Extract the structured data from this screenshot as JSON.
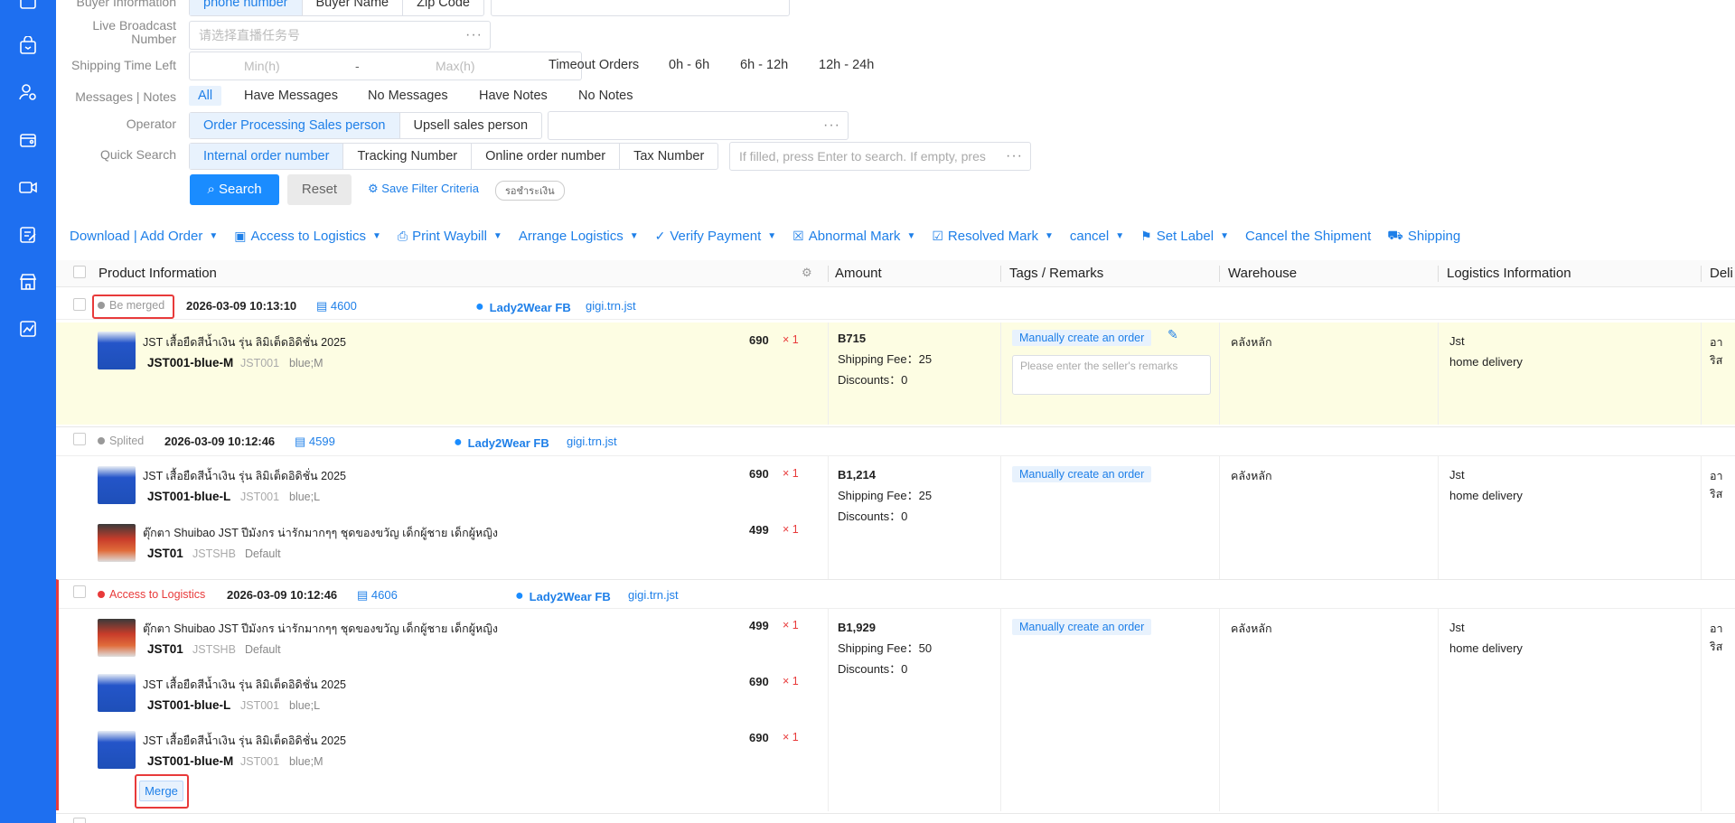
{
  "filters": {
    "buyer_info_label": "Buyer Information",
    "buyer_info_options": [
      "phone number",
      "Buyer Name",
      "Zip Code"
    ],
    "live_label": "Live Broadcast Number",
    "live_placeholder": "请选择直播任务号",
    "shipping_label": "Shipping Time Left",
    "min_placeholder": "Min(h)",
    "range_sep": "-",
    "max_placeholder": "Max(h)",
    "timeout_options": [
      "Timeout Orders",
      "0h - 6h",
      "6h - 12h",
      "12h - 24h"
    ],
    "messages_label": "Messages | Notes",
    "messages_options": [
      "All",
      "Have Messages",
      "No Messages",
      "Have Notes",
      "No Notes"
    ],
    "operator_label": "Operator",
    "operator_options": [
      "Order Processing Sales person",
      "Upsell sales person"
    ],
    "quick_label": "Quick Search",
    "quick_options": [
      "Internal order number",
      "Tracking Number",
      "Online order number",
      "Tax Number"
    ],
    "quick_placeholder": "If filled, press Enter to search. If empty, pres",
    "search_button": "Search",
    "reset_button": "Reset",
    "save_filter": "Save Filter Criteria",
    "saved_pill": "รอชำระเงิน"
  },
  "toolbar": [
    "Download | Add Order",
    "Access to Logistics",
    "Print Waybill",
    "Arrange Logistics",
    "Verify Payment",
    "Abnormal Mark",
    "Resolved Mark",
    "cancel",
    "Set Label",
    "Cancel the Shipment",
    "Shipping"
  ],
  "table_headers": {
    "product": "Product Information",
    "amount": "Amount",
    "tags": "Tags / Remarks",
    "warehouse": "Warehouse",
    "logistics": "Logistics Information",
    "delivery": "Deli"
  },
  "orders": [
    {
      "status": "Be merged",
      "date": "2026-03-09 10:13:10",
      "id": "4600",
      "shop": "Lady2Wear FB",
      "account": "gigi.trn.jst",
      "items": [
        {
          "name": "JST เสื้อยืดสีน้ำเงิน รุ่น ลิมิเต็ดอิดิชั่น 2025",
          "sku": "JST001-blue-M",
          "code": "JST001",
          "variant": "blue;M",
          "price": "690",
          "qty": "× 1"
        }
      ],
      "total": "B715",
      "shipping_fee": "Shipping Fee：25",
      "discounts": "Discounts：0",
      "tag": "Manually create an order",
      "remark_placeholder": "Please enter the seller's remarks",
      "warehouse": "คลังหลัก",
      "logistics_company": "Jst",
      "logistics_type": "home delivery",
      "delivery": "อาริส"
    },
    {
      "status": "Splited",
      "date": "2026-03-09 10:12:46",
      "id": "4599",
      "shop": "Lady2Wear FB",
      "account": "gigi.trn.jst",
      "items": [
        {
          "name": "JST เสื้อยืดสีน้ำเงิน รุ่น ลิมิเต็ดอิดิชั่น 2025",
          "sku": "JST001-blue-L",
          "code": "JST001",
          "variant": "blue;L",
          "price": "690",
          "qty": "× 1"
        },
        {
          "name": "ตุ๊กตา Shuibao JST ปีมังกร น่ารักมากๆๆ ชุดของขวัญ เด็กผู้ชาย เด็กผู้หญิง",
          "sku": "JST01",
          "code": "JSTSHB",
          "variant": "Default",
          "price": "499",
          "qty": "× 1"
        }
      ],
      "total": "B1,214",
      "shipping_fee": "Shipping Fee：25",
      "discounts": "Discounts：0",
      "tag": "Manually create an order",
      "warehouse": "คลังหลัก",
      "logistics_company": "Jst",
      "logistics_type": "home delivery",
      "delivery": "อาริส"
    },
    {
      "status": "Access to Logistics",
      "date": "2026-03-09 10:12:46",
      "id": "4606",
      "shop": "Lady2Wear FB",
      "account": "gigi.trn.jst",
      "items": [
        {
          "name": "ตุ๊กตา Shuibao JST ปีมังกร น่ารักมากๆๆ ชุดของขวัญ เด็กผู้ชาย เด็กผู้หญิง",
          "sku": "JST01",
          "code": "JSTSHB",
          "variant": "Default",
          "price": "499",
          "qty": "× 1"
        },
        {
          "name": "JST เสื้อยืดสีน้ำเงิน รุ่น ลิมิเต็ดอิดิชั่น 2025",
          "sku": "JST001-blue-L",
          "code": "JST001",
          "variant": "blue;L",
          "price": "690",
          "qty": "× 1"
        },
        {
          "name": "JST เสื้อยืดสีน้ำเงิน รุ่น ลิมิเต็ดอิดิชั่น 2025",
          "sku": "JST001-blue-M",
          "code": "JST001",
          "variant": "blue;M",
          "price": "690",
          "qty": "× 1"
        }
      ],
      "total": "B1,929",
      "shipping_fee": "Shipping Fee：50",
      "discounts": "Discounts：0",
      "tag": "Manually create an order",
      "warehouse": "คลังหลัก",
      "logistics_company": "Jst",
      "logistics_type": "home delivery",
      "delivery": "อาริส",
      "merge_button": "Merge"
    }
  ],
  "colors": {
    "sidebar": "#1e6ff0",
    "accent": "#1e7fe8",
    "highlight_row": "#fdfde3",
    "alert": "#e83a3a"
  }
}
